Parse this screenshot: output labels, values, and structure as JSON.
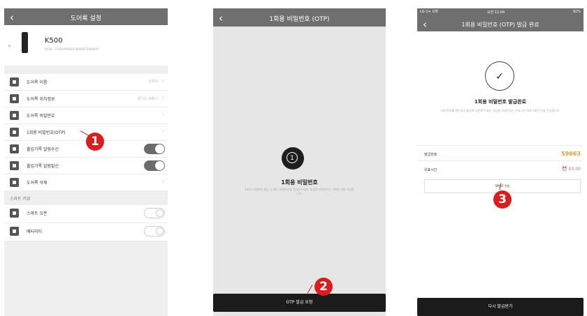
{
  "panel1": {
    "title": "도어록 설정",
    "device": {
      "name": "K500",
      "sub": "BA18 · CFK0UPK0D0CIK0BI0CD0K0I0I5"
    },
    "rows": [
      {
        "label": "도어록 이름",
        "value": "K500",
        "control": "chevron"
      },
      {
        "label": "도어록 위치정보",
        "value": "경기도 세종시",
        "control": "chevron"
      },
      {
        "label": "도어록 비밀번호",
        "value": "",
        "control": "chevron"
      },
      {
        "label": "1회용 비밀번호(OTP)",
        "value": "",
        "control": "chevron"
      },
      {
        "label": "출입기록 알림수신",
        "value": "",
        "control": "toggle-on"
      },
      {
        "label": "출입기록 알림발신",
        "value": "",
        "control": "toggle-on"
      },
      {
        "label": "도어록 삭제",
        "value": "",
        "control": "chevron"
      }
    ],
    "section_title": "스마트 키위",
    "smart_rows": [
      {
        "label": "스마트 오픈",
        "control": "toggle-off"
      },
      {
        "label": "배터리티",
        "control": "toggle-off"
      }
    ],
    "badge": "1"
  },
  "panel2": {
    "title": "1회용 비밀번호 (OTP)",
    "otp_glyph": "1",
    "heading": "1회용 비밀번호",
    "desc": "1회성 비밀번호 발급 시 해당 비밀번호를 발급받으세요. 발급된 비밀번호는 1회만 사용 가능합니다.",
    "button": "OTP 발급 요청",
    "badge": "2"
  },
  "panel3": {
    "status_left": "LG U+ LTE",
    "status_time": "오전 11:04",
    "status_right": "92%",
    "title": "1회용 비밀번호 (OTP) 발급 완료",
    "check": "✓",
    "heading": "1회용 비밀번호 발급완료",
    "desc": "아래 번호를 확인하여 출입에 사용해 주세요. 발급된 비밀번호는 유효시간 내에 1회만 사용 가능합니다.",
    "num_label": "발급번호",
    "num_value": "59863",
    "time_label": "유효시간",
    "time_value": "03:00",
    "sms_button": "SMS로 전송",
    "button": "다시 발급받기",
    "badge": "3"
  }
}
